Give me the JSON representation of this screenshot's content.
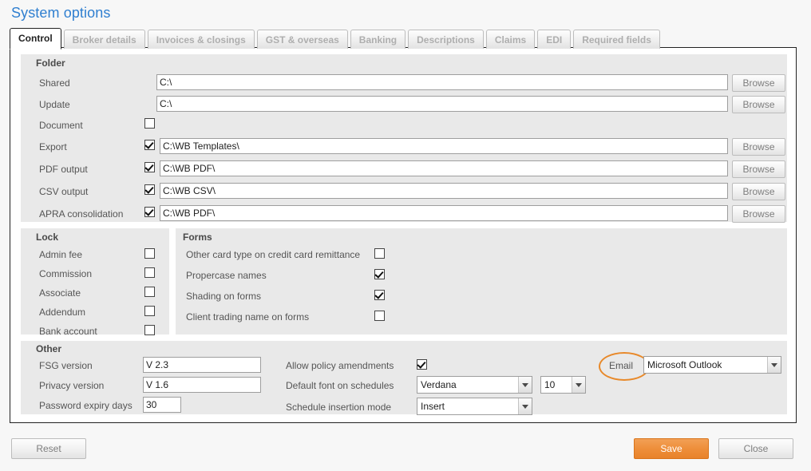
{
  "window": {
    "title": "System options"
  },
  "tabs": [
    {
      "label": "Control",
      "active": true
    },
    {
      "label": "Broker details",
      "active": false
    },
    {
      "label": "Invoices & closings",
      "active": false
    },
    {
      "label": "GST & overseas",
      "active": false
    },
    {
      "label": "Banking",
      "active": false
    },
    {
      "label": "Descriptions",
      "active": false
    },
    {
      "label": "Claims",
      "active": false
    },
    {
      "label": "EDI",
      "active": false
    },
    {
      "label": "Required fields",
      "active": false
    }
  ],
  "folder": {
    "title": "Folder",
    "browse_label": "Browse",
    "rows": [
      {
        "label": "Shared",
        "checkbox": false,
        "has_checkbox": false,
        "value": "C:\\",
        "browse": true
      },
      {
        "label": "Update",
        "checkbox": false,
        "has_checkbox": false,
        "value": "C:\\",
        "browse": true
      },
      {
        "label": "Document",
        "checkbox": false,
        "has_checkbox": true,
        "value": "",
        "browse": false
      },
      {
        "label": "Export",
        "checkbox": true,
        "has_checkbox": true,
        "value": "C:\\WB Templates\\",
        "browse": true
      },
      {
        "label": "PDF output",
        "checkbox": true,
        "has_checkbox": true,
        "value": "C:\\WB PDF\\",
        "browse": true
      },
      {
        "label": "CSV output",
        "checkbox": true,
        "has_checkbox": true,
        "value": "C:\\WB CSV\\",
        "browse": true
      },
      {
        "label": "APRA consolidation",
        "checkbox": true,
        "has_checkbox": true,
        "value": "C:\\WB PDF\\",
        "browse": true
      }
    ]
  },
  "lock": {
    "title": "Lock",
    "rows": [
      {
        "label": "Admin fee",
        "checked": false
      },
      {
        "label": "Commission",
        "checked": false
      },
      {
        "label": "Associate",
        "checked": false
      },
      {
        "label": "Addendum",
        "checked": false
      },
      {
        "label": "Bank account",
        "checked": false
      }
    ]
  },
  "forms": {
    "title": "Forms",
    "rows": [
      {
        "label": "Other card type on credit card remittance",
        "checked": false
      },
      {
        "label": "Propercase names",
        "checked": true
      },
      {
        "label": "Shading on forms",
        "checked": true
      },
      {
        "label": "Client trading name on forms",
        "checked": false
      }
    ]
  },
  "other": {
    "title": "Other",
    "fsg_version_label": "FSG version",
    "fsg_version_value": "V 2.3",
    "privacy_version_label": "Privacy version",
    "privacy_version_value": "V 1.6",
    "password_expiry_label": "Password expiry days",
    "password_expiry_value": "30",
    "allow_amendments_label": "Allow policy amendments",
    "allow_amendments_checked": true,
    "default_font_label": "Default font on schedules",
    "default_font_value": "Verdana",
    "default_font_size_value": "10",
    "insertion_mode_label": "Schedule insertion mode",
    "insertion_mode_value": "Insert",
    "email_label": "Email",
    "email_client_value": "Microsoft Outlook"
  },
  "footer": {
    "reset_label": "Reset",
    "save_label": "Save",
    "close_label": "Close"
  },
  "colors": {
    "title_blue": "#2f7fd0",
    "accent_orange": "#e8892a",
    "group_background": "#e9e9e9",
    "page_background": "#f7f7f7"
  }
}
